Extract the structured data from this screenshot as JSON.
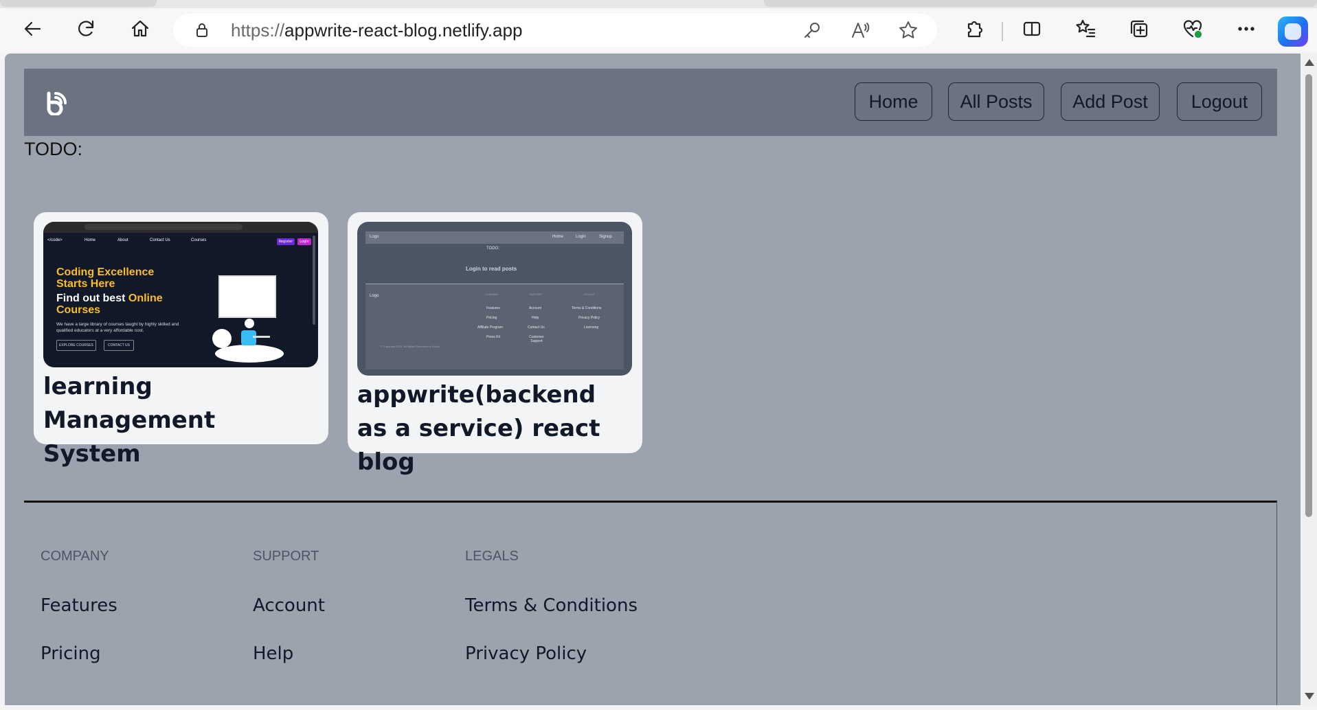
{
  "browser": {
    "url_scheme": "https://",
    "url_host": "appwrite-react-blog.netlify.app"
  },
  "site": {
    "nav": [
      {
        "label": "Home"
      },
      {
        "label": "All Posts"
      },
      {
        "label": "Add Post"
      },
      {
        "label": "Logout"
      }
    ],
    "todo_text": "TODO:"
  },
  "posts": [
    {
      "title": "learning Management System",
      "thumbnail": {
        "nav": [
          "</code>",
          "Home",
          "About",
          "Contact Us",
          "Courses"
        ],
        "register": "Register",
        "login": "Login",
        "headline_line1": "Coding Excellence",
        "headline_line2": "Starts Here",
        "sub_line1": "Find out best",
        "sub_accent1": "Online",
        "sub_line2": "Courses",
        "description": "We have a large library of courses taught by highly skilled and qualified educators at a very affordable cost.",
        "btn_explore": "EXPLORE COURSES",
        "btn_contact": "CONTACT US"
      }
    },
    {
      "title": "appwrite(backend as a service) react blog",
      "thumbnail": {
        "logo": "Logo",
        "nav": [
          "Home",
          "Login",
          "Signup"
        ],
        "todo": "TODO:",
        "message": "Login to read posts",
        "footer_logo": "Logo",
        "col_heads": [
          "COMPANY",
          "SUPPORT",
          "LEGALS"
        ],
        "col1": [
          "Features",
          "Pricing",
          "Affiliate Program",
          "Press Kit"
        ],
        "col2": [
          "Account",
          "Help",
          "Contact Us",
          "Customer Support"
        ],
        "col3": [
          "Terms & Conditions",
          "Privacy Policy",
          "Licensing"
        ],
        "copyright": "© Copyright 2023. All Rights Reserved by DevUI."
      }
    }
  ],
  "footer": {
    "company": {
      "heading": "Company",
      "links": [
        "Features",
        "Pricing"
      ]
    },
    "support": {
      "heading": "Support",
      "links": [
        "Account",
        "Help"
      ]
    },
    "legals": {
      "heading": "Legals",
      "links": [
        "Terms & Conditions",
        "Privacy Policy"
      ]
    }
  }
}
